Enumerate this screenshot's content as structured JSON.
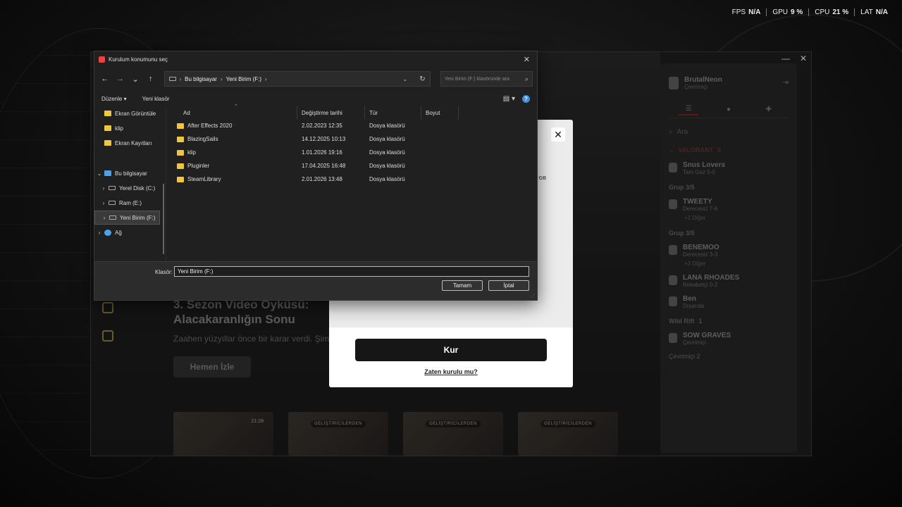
{
  "overlay": {
    "fps_label": "FPS",
    "fps_value": "N/A",
    "gpu_label": "GPU",
    "gpu_value": "9 %",
    "cpu_label": "CPU",
    "cpu_value": "21 %",
    "lat_label": "LAT",
    "lat_value": "N/A"
  },
  "client": {
    "hero_title": "3. Sezon Video Öyküsü: Alacakaranlığın Sonu",
    "hero_desc": "Zaahen yüzyıllar önce bir karar verdi. Şimdi...",
    "watch_button": "Hemen İzle",
    "thumbnails": [
      {
        "badge": "",
        "time": "21:28"
      },
      {
        "badge": "GELİŞTİRİCİLERDEN",
        "time": ""
      },
      {
        "badge": "GELİŞTİRİCİLERDEN",
        "time": ""
      },
      {
        "badge": "GELİŞTİRİCİLERDEN",
        "time": ""
      }
    ]
  },
  "friends": {
    "username": "BrutalNeon",
    "user_status": "Çevrimiçi",
    "search_placeholder": "Ara",
    "valorant_group": "VALORANT",
    "valorant_count": "5",
    "friend1_name": "Snus Lovers",
    "friend1_status": "Tam Gaz 5-0",
    "group1_label": "Grup 3/5",
    "friend2_name": "TWEETY",
    "friend2_status": "Derecesiz 7-6",
    "group1_more": "+2 Diğer",
    "group2_label": "Grup 3/5",
    "friend3_name": "BENEMOO",
    "friend3_status": "Derecesiz 3-3",
    "group2_more": "+3 Diğer",
    "friend4_name": "LANA RHOADES",
    "friend4_status": "Rekabetçi 0-2",
    "friend5_name": "Ben",
    "friend5_status": "Dışarıda",
    "wildrift_group": "Wild Rift",
    "wildrift_count": "1",
    "friend6_name": "SOW GRAVES",
    "friend6_status": "Çevrimiçi",
    "online_label": "Çevrimiçi",
    "online_count": "2"
  },
  "install_modal": {
    "close": "✕",
    "gb_label": "GB",
    "install_button": "Kur",
    "already_installed": "Zaten kurulu mu?"
  },
  "dialog": {
    "title": "Kurulum konumunu seç",
    "close": "✕",
    "address": {
      "crumb1": "Bu bilgisayar",
      "crumb2": "Yeni Birim (F:)"
    },
    "search_placeholder": "Yeni Birim (F:) klasöründe ara",
    "organize_label": "Düzenle",
    "new_folder_label": "Yeni klasör",
    "tree": [
      {
        "label": "Ekran Görüntüle",
        "kind": "folder"
      },
      {
        "label": "klip",
        "kind": "folder"
      },
      {
        "label": "Ekran Kayıtları",
        "kind": "folder"
      },
      {
        "label": "Bu bilgisayar",
        "kind": "pc"
      },
      {
        "label": "Yerel Disk (C:)",
        "kind": "drive"
      },
      {
        "label": "Ram (E:)",
        "kind": "drive"
      },
      {
        "label": "Yeni Birim (F:)",
        "kind": "drive"
      },
      {
        "label": "Ağ",
        "kind": "network"
      }
    ],
    "columns": {
      "name": "Ad",
      "modified": "Değiştirme tarihi",
      "type": "Tür",
      "size": "Boyut"
    },
    "files": [
      {
        "name": "After Effects 2020",
        "modified": "2.02.2023 12:35",
        "type": "Dosya klasörü"
      },
      {
        "name": "BlazingSails",
        "modified": "14.12.2025 10:13",
        "type": "Dosya klasörü"
      },
      {
        "name": "klip",
        "modified": "1.01.2026 19:16",
        "type": "Dosya klasörü"
      },
      {
        "name": "Pluginler",
        "modified": "17.04.2025 16:48",
        "type": "Dosya klasörü"
      },
      {
        "name": "SteamLibrary",
        "modified": "2.01.2026 13:48",
        "type": "Dosya klasörü"
      }
    ],
    "folder_label": "Klasör:",
    "folder_value": "Yeni Birim (F:)",
    "ok_button": "Tamam",
    "cancel_button": "İptal"
  },
  "colors": {
    "accent_red": "#e8433e",
    "folder_yellow": "#f0c640",
    "help_blue": "#3a8ee6"
  }
}
